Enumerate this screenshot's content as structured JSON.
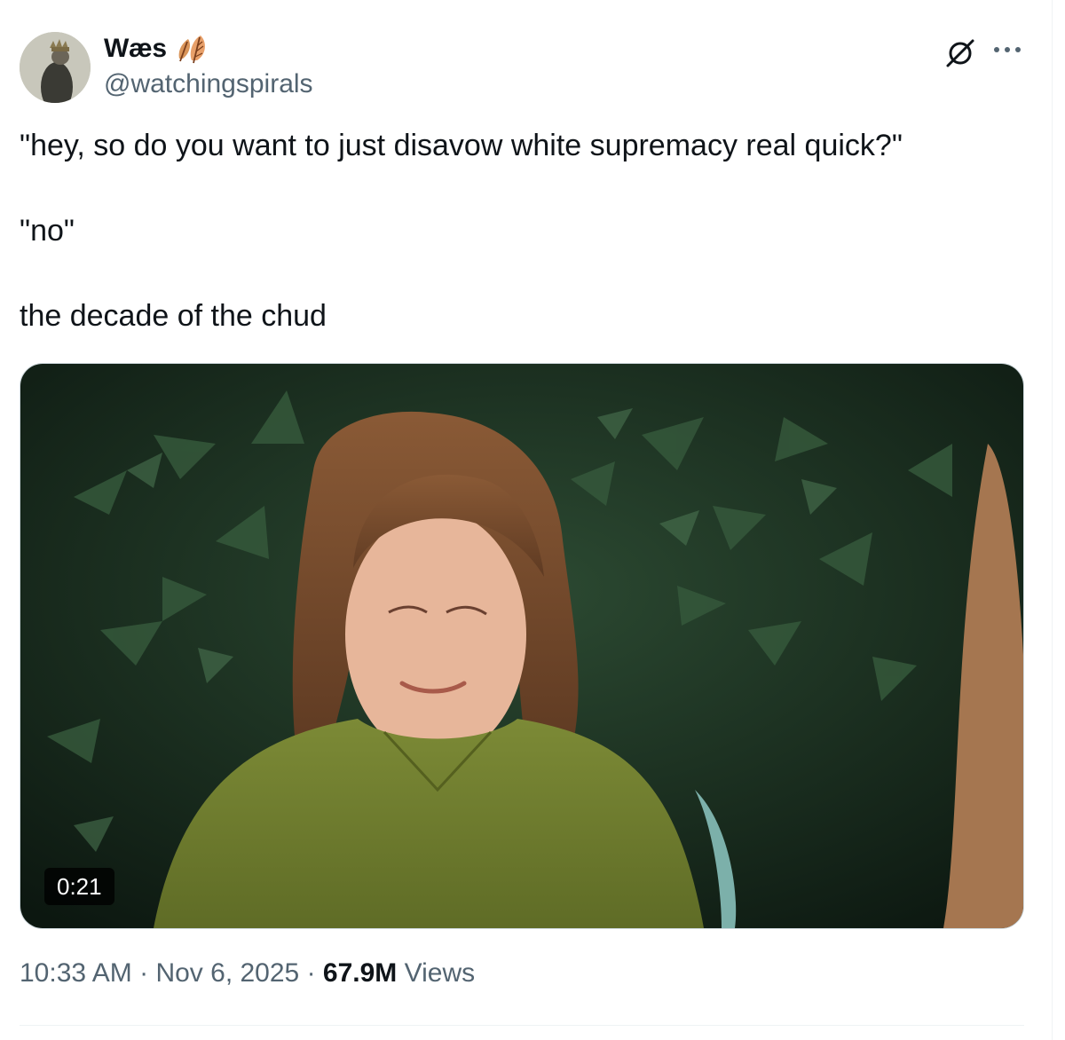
{
  "author": {
    "display_name": "Wæs",
    "handle": "@watchingspirals",
    "name_emoji": "leaf-pair-icon"
  },
  "actions": {
    "grok_icon": "grok-icon",
    "more_icon": "more-icon"
  },
  "tweet": {
    "lines": [
      "\"hey, so do you want to just disavow white supremacy real quick?\"",
      "\"no\"",
      "the decade of the chud"
    ]
  },
  "media": {
    "type": "video",
    "duration": "0:21"
  },
  "meta": {
    "time": "10:33 AM",
    "separator": "·",
    "date": "Nov 6, 2025",
    "views_count": "67.9M",
    "views_label": "Views"
  },
  "colors": {
    "text_primary": "#0f1419",
    "text_secondary": "#536471",
    "border": "#cfd9de"
  }
}
